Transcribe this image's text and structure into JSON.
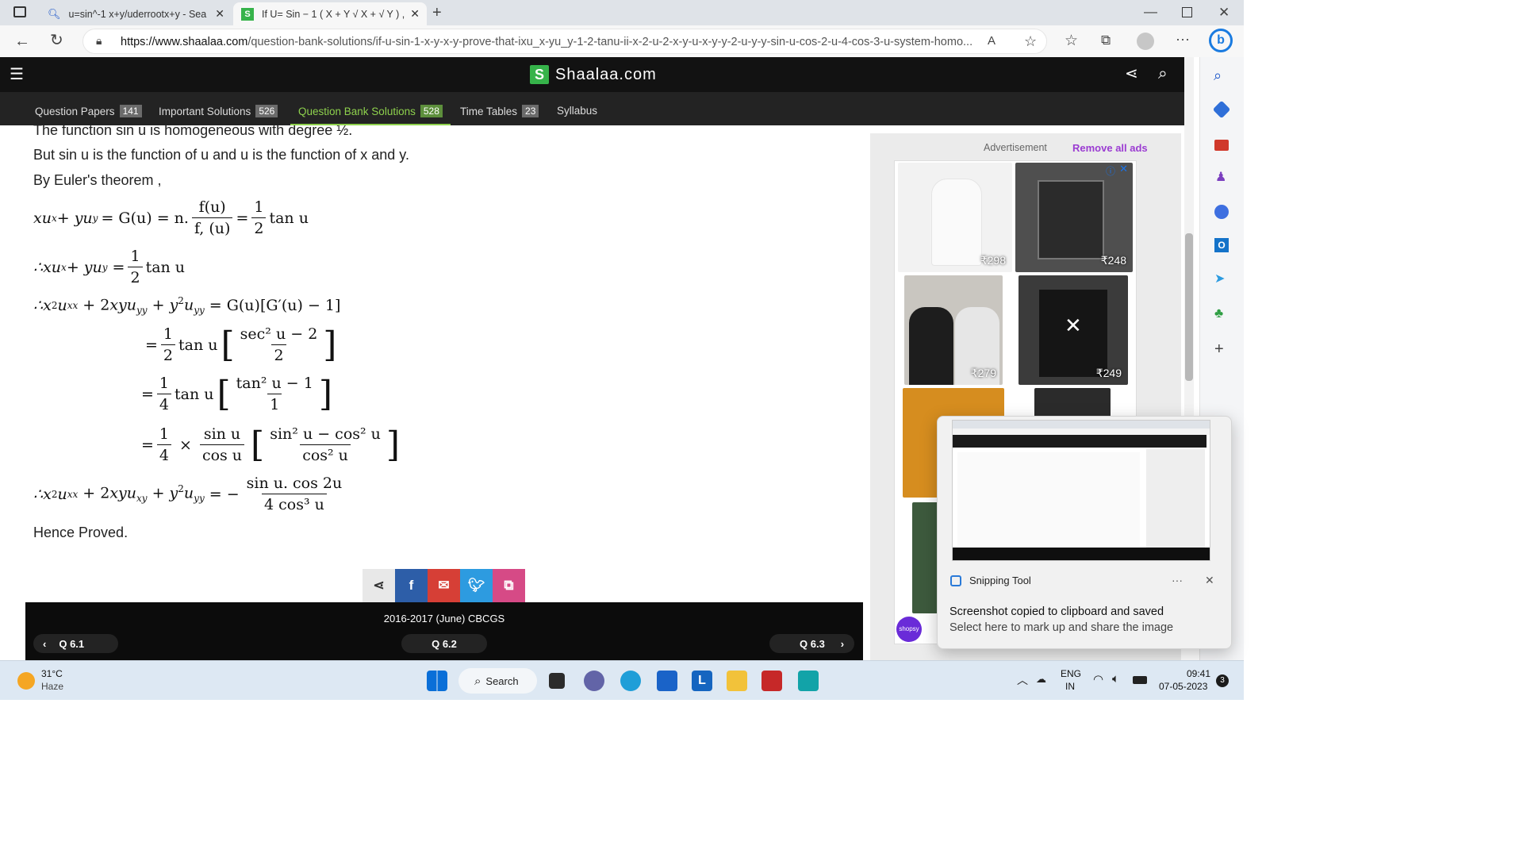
{
  "tabs": [
    {
      "title": "u=sin^-1 x+y/uderrootx+y - Sea"
    },
    {
      "title": "If U= Sin − 1 ( X + Y √ X + √ Y ) ,"
    }
  ],
  "url": {
    "domain": "https://www.shaalaa.com",
    "path": "/question-bank-solutions/if-u-sin-1-x-y-x-y-prove-that-ixu_x-yu_y-1-2-tanu-ii-x-2-u-2-x-y-u-x-y-y-2-u-y-y-sin-u-cos-2-u-4-cos-3-u-system-homo..."
  },
  "site": {
    "logo_letter": "S",
    "name": "Shaalaa.com"
  },
  "nav": [
    {
      "label": "Question Papers",
      "count": "141"
    },
    {
      "label": "Important Solutions",
      "count": "526"
    },
    {
      "label": "Question Bank Solutions",
      "count": "528"
    },
    {
      "label": "Time Tables",
      "count": "23"
    },
    {
      "label": "Syllabus",
      "count": ""
    }
  ],
  "content": {
    "line0": "The function sin u is homogeneous with degree ½.",
    "line1": "But sin u is the function of u and u is the function of x and y.",
    "line2": "By Euler's theorem ,",
    "hence": "Hence Proved."
  },
  "math": {
    "eq1a": "xu",
    "eq1b": "x",
    "eq1c": " + yu",
    "eq1d": "y",
    "eq1e": " = G(u) = n.",
    "eq1num": "f(u)",
    "eq1den": "f, (u)",
    "eq1f": "=",
    "one": "1",
    "two": "2",
    "tan": "tan u",
    "eq2": "∴xu",
    "eq3lhs": "∴x",
    "eq3rhs": "= G(u)[G′(u) − 1]",
    "s1num": "sec² u − 2",
    "s1den": "2",
    "four": "4",
    "s2num": "tan² u − 1",
    "s2den": "1",
    "sinu": "sin u",
    "cosu": "cos u",
    "s3num": "sin² u − cos² u",
    "s3den": "cos² u",
    "times": "×",
    "fnum": "sin u. cos 2u",
    "fden": "4 cos³ u",
    "minus": "= −"
  },
  "footer": {
    "exam": "2016-2017 (June) CBCGS",
    "prev": "Q 6.1",
    "cur": "Q 6.2",
    "next": "Q 6.3"
  },
  "ad": {
    "label": "Advertisement",
    "remove": "Remove all ads",
    "prices": [
      "₹298",
      "₹248",
      "₹279",
      "₹249"
    ],
    "brand": "shopsy"
  },
  "toast": {
    "app": "Snipping Tool",
    "title": "Screenshot copied to clipboard and saved",
    "body": "Select here to mark up and share the image",
    "more": "···"
  },
  "taskbar": {
    "temp": "31°C",
    "weather": "Haze",
    "search": "Search",
    "lang1": "ENG",
    "lang2": "IN",
    "time": "09:41",
    "date": "07-05-2023",
    "badge": "3"
  },
  "colors": {
    "green": "#36b34a",
    "navActive": "#8ed14d",
    "fb": "#2d5ea8",
    "mail": "#d63f36",
    "tw": "#2d9be0",
    "copy": "#d64a86",
    "remove": "#9b3cd2"
  }
}
